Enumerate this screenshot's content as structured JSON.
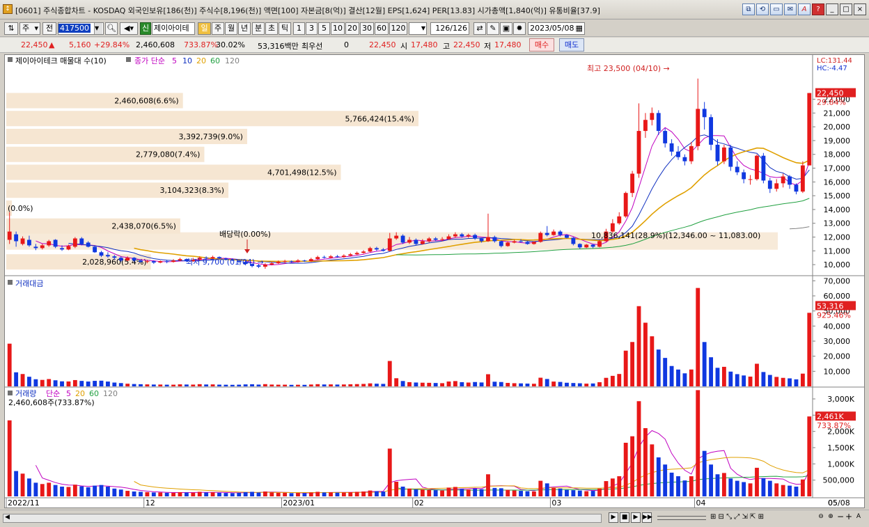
{
  "title": "[0601] 주식종합차트 - KOSDAQ 외국인보유[186(천)] 주식수[8,196(천)] 액면[100] 자본금[8(억)] 결산[12월] EPS[1,624] PER[13.83] 시가총액[1,840(억)] 유통비율[37.9]",
  "window_buttons": [
    "⧉",
    "⟲",
    "▭",
    "✉",
    "A",
    "?",
    "_",
    "□",
    "×"
  ],
  "toolbar": {
    "period_select": "주",
    "prev_label": "전",
    "code_value": "417500",
    "stock_name": "제이아이테",
    "periods": [
      "일",
      "주",
      "월",
      "년",
      "분",
      "초",
      "틱"
    ],
    "active_period": "일",
    "minutes": [
      "1",
      "3",
      "5",
      "10",
      "20",
      "30",
      "60",
      "120"
    ],
    "count_value": "126",
    "count_total": "/126",
    "date_value": "2023/05/08"
  },
  "quote": {
    "price": "22,450",
    "change": "5,160",
    "change_pct": "+29.84%",
    "volume": "2,460,608",
    "vol_ratio": "733.87%",
    "turnover": "30.02%",
    "amount": "53,316백만",
    "preferred_label": "최우선",
    "preferred_value": "0",
    "ask": "22,450",
    "open_label": "시",
    "open_value": "17,480",
    "high_label": "고",
    "high_value": "22,450",
    "low_label": "저",
    "low_value": "17,480",
    "buy_label": "매수",
    "sell_label": "매도"
  },
  "chart_data": {
    "type": "candlestick",
    "price_panel": {
      "legend_title": "제이아이테크 매물대 수(10)",
      "legend_ma_prefix": "종가 단순",
      "ma_periods": [
        "5",
        "10",
        "20",
        "60",
        "120"
      ],
      "ma_colors": [
        "#c000c0",
        "#1030c0",
        "#e0a000",
        "#20a040",
        "#808080"
      ],
      "y_ticks": [
        "10,000",
        "11,000",
        "12,000",
        "13,000",
        "14,000",
        "15,000",
        "16,000",
        "17,000",
        "18,000",
        "19,000",
        "20,000",
        "21,000",
        "22,000"
      ],
      "ylim": [
        9300,
        24300
      ],
      "lc_label": "LC:131.44",
      "hc_label": "HC:-4.47",
      "last_price_label": "22,450",
      "last_pct_label": "29.84%",
      "high_annotation": "최고 23,500 (04/10) →",
      "low_annotation": "최저 9,700 (01/04) →",
      "dividend_annotation": "배당락(0.00%)",
      "current_profile_label": "10,836,141(28.9%)(12,346.00 ~ 11,083.00)",
      "volume_profile": [
        {
          "label": "2,460,608(6.6%)",
          "price": 21900,
          "share": 6.6
        },
        {
          "label": "5,766,424(15.4%)",
          "price": 20600,
          "share": 15.4
        },
        {
          "label": "3,392,739(9.0%)",
          "price": 19300,
          "share": 9.0
        },
        {
          "label": "2,779,080(7.4%)",
          "price": 18000,
          "share": 7.4
        },
        {
          "label": "4,701,498(12.5%)",
          "price": 16700,
          "share": 12.5
        },
        {
          "label": "3,104,323(8.3%)",
          "price": 15400,
          "share": 8.3
        },
        {
          "label": "(0.0%)",
          "price": 14100,
          "share": 0.0
        },
        {
          "label": "2,438,070(6.5%)",
          "price": 12800,
          "share": 6.5
        },
        {
          "label": "2,028,960(5.4%)",
          "price": 10200,
          "share": 5.4
        }
      ]
    },
    "amount_panel": {
      "legend_title": "거래대금",
      "y_ticks": [
        "10,000",
        "20,000",
        "30,000",
        "40,000",
        "50,000",
        "60,000",
        "70,000"
      ],
      "ylim": [
        0,
        72000
      ],
      "last_value_label": "53,316",
      "last_pct_label": "925.46%"
    },
    "volume_panel": {
      "legend_title": "거래량",
      "legend_ma_prefix": "단순",
      "legend_value": "2,460,608주(733.87%)",
      "y_ticks": [
        "500,000",
        "1,000K",
        "1,500K",
        "2,000K",
        "2,500K",
        "3,000K"
      ],
      "ylim": [
        0,
        3300000
      ],
      "last_value_label": "2,461K",
      "last_pct_label": "733.87%"
    },
    "x_labels": [
      {
        "label": "2022/11",
        "index": 0
      },
      {
        "label": "12",
        "index": 21
      },
      {
        "label": "2023/01",
        "index": 42
      },
      {
        "label": "02",
        "index": 62
      },
      {
        "label": "03",
        "index": 83
      },
      {
        "label": "04",
        "index": 105
      },
      {
        "label": "05",
        "index": 125
      },
      {
        "label": "05/08",
        "index": 133
      }
    ],
    "candles": [
      [
        11800,
        12400,
        13800,
        11500,
        2340000
      ],
      [
        12200,
        11700,
        12400,
        11300,
        780000
      ],
      [
        11500,
        11900,
        12050,
        11400,
        700000
      ],
      [
        11800,
        11400,
        12100,
        11300,
        550000
      ],
      [
        11300,
        11200,
        11500,
        11050,
        420000
      ],
      [
        11200,
        11400,
        11500,
        11100,
        380000
      ],
      [
        11400,
        11700,
        11800,
        11300,
        420000
      ],
      [
        11800,
        11300,
        11850,
        11200,
        350000
      ],
      [
        11200,
        11100,
        11400,
        11000,
        300000
      ],
      [
        11100,
        11350,
        11450,
        11050,
        290000
      ],
      [
        11300,
        11900,
        12000,
        11200,
        360000
      ],
      [
        11900,
        11500,
        12000,
        11400,
        310000
      ],
      [
        11600,
        11300,
        11700,
        11250,
        280000
      ],
      [
        11300,
        10900,
        11350,
        10850,
        330000
      ],
      [
        10900,
        10650,
        11000,
        10550,
        350000
      ],
      [
        10700,
        10600,
        10900,
        10500,
        300000
      ],
      [
        10600,
        10500,
        10700,
        10350,
        240000
      ],
      [
        10500,
        10300,
        10600,
        10200,
        210000
      ],
      [
        10300,
        10500,
        10600,
        10250,
        170000
      ],
      [
        10500,
        10300,
        10550,
        10200,
        150000
      ],
      [
        10300,
        10200,
        10400,
        10150,
        140000
      ],
      [
        10200,
        10250,
        10350,
        10100,
        130000
      ],
      [
        10250,
        10150,
        10300,
        10050,
        120000
      ],
      [
        10150,
        10250,
        10300,
        10100,
        120000
      ],
      [
        10250,
        10200,
        10350,
        10100,
        110000
      ],
      [
        10200,
        10300,
        10400,
        10150,
        110000
      ],
      [
        10300,
        10400,
        10500,
        10250,
        130000
      ],
      [
        10400,
        10250,
        10450,
        10200,
        120000
      ],
      [
        10250,
        10350,
        10500,
        10200,
        115000
      ],
      [
        10350,
        10500,
        10600,
        10300,
        140000
      ],
      [
        10500,
        10450,
        10600,
        10350,
        120000
      ],
      [
        10450,
        10550,
        10650,
        10400,
        125000
      ],
      [
        10550,
        10450,
        10600,
        10350,
        110000
      ],
      [
        10450,
        10350,
        10500,
        10300,
        105000
      ],
      [
        10350,
        10300,
        10450,
        10250,
        100000
      ],
      [
        10300,
        10200,
        10350,
        10100,
        110000
      ],
      [
        10200,
        10050,
        10300,
        9950,
        130000
      ],
      [
        10050,
        9900,
        10100,
        9800,
        140000
      ],
      [
        9950,
        9850,
        10050,
        9750,
        120000
      ],
      [
        9850,
        10000,
        10100,
        9700,
        150000
      ],
      [
        10000,
        10100,
        10200,
        9950,
        120000
      ],
      [
        10100,
        10200,
        10300,
        10050,
        110000
      ],
      [
        10200,
        10250,
        10350,
        10100,
        110000
      ],
      [
        10250,
        10200,
        10300,
        10150,
        100000
      ],
      [
        10200,
        10300,
        10400,
        10150,
        105000
      ],
      [
        10300,
        10250,
        10350,
        10200,
        100000
      ],
      [
        10250,
        10400,
        10500,
        10200,
        120000
      ],
      [
        10400,
        10550,
        10650,
        10350,
        140000
      ],
      [
        10550,
        10500,
        10650,
        10450,
        120000
      ],
      [
        10500,
        10600,
        10700,
        10450,
        125000
      ],
      [
        10600,
        10550,
        10700,
        10500,
        115000
      ],
      [
        10550,
        10650,
        10750,
        10500,
        120000
      ],
      [
        10650,
        10750,
        10850,
        10600,
        130000
      ],
      [
        10750,
        10850,
        10950,
        10700,
        140000
      ],
      [
        10850,
        10950,
        11050,
        10800,
        150000
      ],
      [
        10950,
        11200,
        11300,
        10900,
        180000
      ],
      [
        11200,
        11100,
        11300,
        11000,
        160000
      ],
      [
        11100,
        11000,
        11200,
        10950,
        150000
      ],
      [
        11000,
        11900,
        12300,
        10950,
        1470000
      ],
      [
        11900,
        12100,
        12350,
        11800,
        450000
      ],
      [
        12100,
        11600,
        12200,
        11500,
        300000
      ],
      [
        11600,
        11800,
        12000,
        11500,
        240000
      ],
      [
        11800,
        11500,
        11900,
        11400,
        220000
      ],
      [
        11500,
        11700,
        11850,
        11450,
        210000
      ],
      [
        11700,
        11900,
        12000,
        11600,
        200000
      ],
      [
        11900,
        11800,
        12000,
        11700,
        190000
      ],
      [
        11800,
        11850,
        12000,
        11700,
        180000
      ],
      [
        11850,
        12050,
        12200,
        11800,
        270000
      ],
      [
        12050,
        12200,
        12350,
        11950,
        290000
      ],
      [
        12200,
        12050,
        12300,
        11950,
        230000
      ],
      [
        12050,
        12150,
        12250,
        11950,
        210000
      ],
      [
        12150,
        11900,
        12250,
        11800,
        240000
      ],
      [
        11900,
        11700,
        11950,
        11600,
        220000
      ],
      [
        11700,
        12000,
        13700,
        11650,
        680000
      ],
      [
        12000,
        11700,
        12100,
        11600,
        260000
      ],
      [
        11700,
        11350,
        11750,
        11250,
        250000
      ],
      [
        11350,
        11600,
        11700,
        11300,
        200000
      ],
      [
        11600,
        11700,
        11800,
        11550,
        180000
      ],
      [
        11700,
        11650,
        11850,
        11600,
        170000
      ],
      [
        11650,
        11500,
        11700,
        11450,
        160000
      ],
      [
        11500,
        11650,
        11700,
        11450,
        150000
      ],
      [
        11650,
        12300,
        12400,
        11600,
        480000
      ],
      [
        12300,
        12150,
        12800,
        12050,
        400000
      ],
      [
        12150,
        12400,
        12550,
        12100,
        260000
      ],
      [
        12400,
        12150,
        12500,
        12050,
        240000
      ],
      [
        12150,
        11950,
        12200,
        11900,
        200000
      ],
      [
        11950,
        11500,
        12000,
        11400,
        190000
      ],
      [
        11500,
        11250,
        11550,
        11150,
        180000
      ],
      [
        11250,
        11450,
        11500,
        11200,
        160000
      ],
      [
        11450,
        11300,
        11500,
        11200,
        170000
      ],
      [
        11300,
        11700,
        11800,
        11250,
        240000
      ],
      [
        11700,
        12400,
        12600,
        11650,
        470000
      ],
      [
        12400,
        13000,
        13300,
        12300,
        550000
      ],
      [
        13000,
        13500,
        13800,
        12900,
        620000
      ],
      [
        13500,
        15200,
        15300,
        13400,
        1650000
      ],
      [
        15200,
        16600,
        16800,
        14900,
        1850000
      ],
      [
        16600,
        19700,
        21700,
        16300,
        2930000
      ],
      [
        19700,
        20500,
        21000,
        19200,
        2100000
      ],
      [
        20500,
        21000,
        21400,
        20100,
        1600000
      ],
      [
        21000,
        19700,
        21200,
        19400,
        1200000
      ],
      [
        19700,
        18800,
        19900,
        18500,
        980000
      ],
      [
        18800,
        18200,
        19100,
        17900,
        730000
      ],
      [
        18200,
        17800,
        18600,
        17600,
        620000
      ],
      [
        17800,
        17500,
        18000,
        17200,
        490000
      ],
      [
        17500,
        18600,
        18900,
        17300,
        620000
      ],
      [
        18600,
        21300,
        23500,
        18300,
        3270000
      ],
      [
        21300,
        20700,
        21800,
        19800,
        1400000
      ],
      [
        20700,
        18700,
        20900,
        18300,
        980000
      ],
      [
        18700,
        17500,
        19100,
        17200,
        680000
      ],
      [
        17500,
        18500,
        18700,
        17300,
        720000
      ],
      [
        18500,
        17100,
        18700,
        16800,
        550000
      ],
      [
        17100,
        16700,
        17500,
        16500,
        480000
      ],
      [
        16700,
        16200,
        16900,
        15900,
        440000
      ],
      [
        16200,
        16200,
        16500,
        15800,
        400000
      ],
      [
        16200,
        17900,
        18000,
        16100,
        880000
      ],
      [
        17900,
        16100,
        18100,
        15900,
        560000
      ],
      [
        16100,
        15500,
        16300,
        15200,
        480000
      ],
      [
        15500,
        15900,
        16200,
        15300,
        400000
      ],
      [
        15900,
        16400,
        16600,
        15600,
        350000
      ],
      [
        16400,
        15800,
        16500,
        15500,
        330000
      ],
      [
        15800,
        15300,
        15900,
        15100,
        300000
      ],
      [
        15300,
        17200,
        17500,
        15200,
        520000
      ],
      [
        17200,
        22450,
        22450,
        17200,
        2460000
      ]
    ]
  },
  "bottom_buttons": [
    "▶",
    "■",
    "▶",
    "▶▶",
    "⊖",
    "⊕",
    "−",
    "+",
    "A"
  ]
}
